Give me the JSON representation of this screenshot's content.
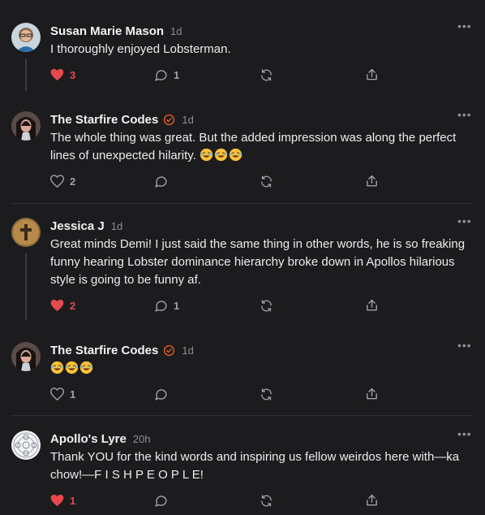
{
  "comments": [
    {
      "author": "Susan Marie Mason",
      "time": "1d",
      "body": "I thoroughly enjoyed Lobsterman.",
      "likes": "3",
      "liked": true,
      "replies": "1",
      "verified": false,
      "avatar": "photo-woman-glasses"
    },
    {
      "author": "The Starfire Codes",
      "time": "1d",
      "body": "The whole thing was great. But the added impression was along the perfect lines of unexpected hilarity.",
      "emoji": "😂😂😂",
      "likes": "2",
      "liked": false,
      "replies": "",
      "verified": true,
      "avatar": "photo-dark-hair"
    },
    {
      "author": "Jessica J",
      "time": "1d",
      "body": "Great minds Demi! I just said the same thing in other words, he is so freaking funny hearing Lobster dominance hierarchy broke down in Apollos hilarious style is going to be funny af.",
      "likes": "2",
      "liked": true,
      "replies": "1",
      "verified": false,
      "avatar": "photo-cross"
    },
    {
      "author": "The Starfire Codes",
      "time": "1d",
      "body": "",
      "emoji": "😂😂😂",
      "likes": "1",
      "liked": false,
      "replies": "",
      "verified": true,
      "avatar": "photo-dark-hair"
    },
    {
      "author": "Apollo's Lyre",
      "time": "20h",
      "body": "Thank YOU for the kind words and inspiring us fellow weirdos here with—ka chow!—F I S H P E O P L E!",
      "likes": "1",
      "liked": true,
      "replies": "",
      "verified": false,
      "avatar": "mandala-logo"
    }
  ],
  "icons": {
    "like": "heart-icon",
    "reply": "speech-bubble-icon",
    "restack": "restack-icon",
    "share": "share-icon",
    "more": "ellipsis-icon",
    "verified": "check-badge-icon"
  },
  "colors": {
    "background": "#1c1c1e",
    "text": "#ececee",
    "muted": "#8e8e93",
    "like_active": "#e5484d",
    "badge": "#ff6719"
  }
}
